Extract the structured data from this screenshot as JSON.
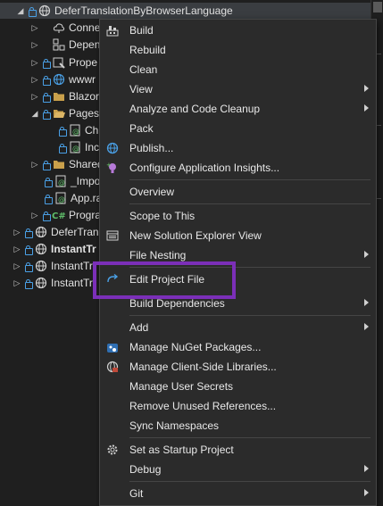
{
  "tree": {
    "items": [
      {
        "label": "DeferTranslationByBrowserLanguage",
        "icon": "web-project-icon",
        "expander": "▲",
        "bold": false
      },
      {
        "label": "Conne",
        "icon": "connected-services-icon",
        "expander": "▷",
        "bold": false
      },
      {
        "label": "Depen",
        "icon": "dependencies-icon",
        "expander": "▷",
        "bold": false
      },
      {
        "label": "Prope",
        "icon": "properties-icon",
        "expander": "▷",
        "bold": false
      },
      {
        "label": "wwwr",
        "icon": "globe-icon",
        "expander": "▷",
        "bold": false
      },
      {
        "label": "Blazor",
        "icon": "folder-icon",
        "expander": "▷",
        "bold": false
      },
      {
        "label": "Pages",
        "icon": "folder-open-icon",
        "expander": "◢",
        "bold": false
      },
      {
        "label": "Ch",
        "icon": "razor-file-icon",
        "expander": "",
        "bold": false
      },
      {
        "label": "Inc",
        "icon": "razor-file-icon",
        "expander": "",
        "bold": false
      },
      {
        "label": "Shared",
        "icon": "folder-icon",
        "expander": "▷",
        "bold": false
      },
      {
        "label": "_Impo",
        "icon": "razor-file-icon",
        "expander": "",
        "bold": false
      },
      {
        "label": "App.ra",
        "icon": "razor-file-icon",
        "expander": "",
        "bold": false
      },
      {
        "label": "Progra",
        "icon": "csharp-file-icon",
        "expander": "▷",
        "bold": false
      },
      {
        "label": "DeferTranslat",
        "icon": "web-project-icon",
        "expander": "▷",
        "bold": false
      },
      {
        "label": "InstantTr",
        "icon": "web-project-icon",
        "expander": "▷",
        "bold": true
      },
      {
        "label": "InstantTr",
        "icon": "web-project-icon",
        "expander": "▷",
        "bold": false
      },
      {
        "label": "InstantTr",
        "icon": "web-project-icon",
        "expander": "▷",
        "bold": false
      }
    ]
  },
  "menu": {
    "items": [
      {
        "label": "Build",
        "icon": "build-icon",
        "submenu": false
      },
      {
        "label": "Rebuild",
        "icon": "",
        "submenu": false
      },
      {
        "label": "Clean",
        "icon": "",
        "submenu": false
      },
      {
        "label": "View",
        "icon": "",
        "submenu": true
      },
      {
        "label": "Analyze and Code Cleanup",
        "icon": "",
        "submenu": true
      },
      {
        "label": "Pack",
        "icon": "",
        "submenu": false
      },
      {
        "label": "Publish...",
        "icon": "publish-globe-icon",
        "submenu": false
      },
      {
        "label": "Configure Application Insights...",
        "icon": "app-insights-icon",
        "submenu": false
      },
      {
        "label": "Overview",
        "icon": "",
        "submenu": false
      },
      {
        "label": "Scope to This",
        "icon": "",
        "submenu": false
      },
      {
        "label": "New Solution Explorer View",
        "icon": "solution-explorer-view-icon",
        "submenu": false
      },
      {
        "label": "File Nesting",
        "icon": "",
        "submenu": true
      },
      {
        "label": "Edit Project File",
        "icon": "edit-project-file-icon",
        "submenu": false
      },
      {
        "label": "Build Dependencies",
        "icon": "",
        "submenu": true
      },
      {
        "label": "Add",
        "icon": "",
        "submenu": true
      },
      {
        "label": "Manage NuGet Packages...",
        "icon": "nuget-icon",
        "submenu": false
      },
      {
        "label": "Manage Client-Side Libraries...",
        "icon": "client-libraries-icon",
        "submenu": false
      },
      {
        "label": "Manage User Secrets",
        "icon": "",
        "submenu": false
      },
      {
        "label": "Remove Unused References...",
        "icon": "",
        "submenu": false
      },
      {
        "label": "Sync Namespaces",
        "icon": "",
        "submenu": false
      },
      {
        "label": "Set as Startup Project",
        "icon": "gear-icon",
        "submenu": false
      },
      {
        "label": "Debug",
        "icon": "",
        "submenu": true
      },
      {
        "label": "Git",
        "icon": "",
        "submenu": true
      }
    ]
  },
  "colors": {
    "highlight": "#7b2fb8",
    "accent": "#4aa0e6"
  }
}
